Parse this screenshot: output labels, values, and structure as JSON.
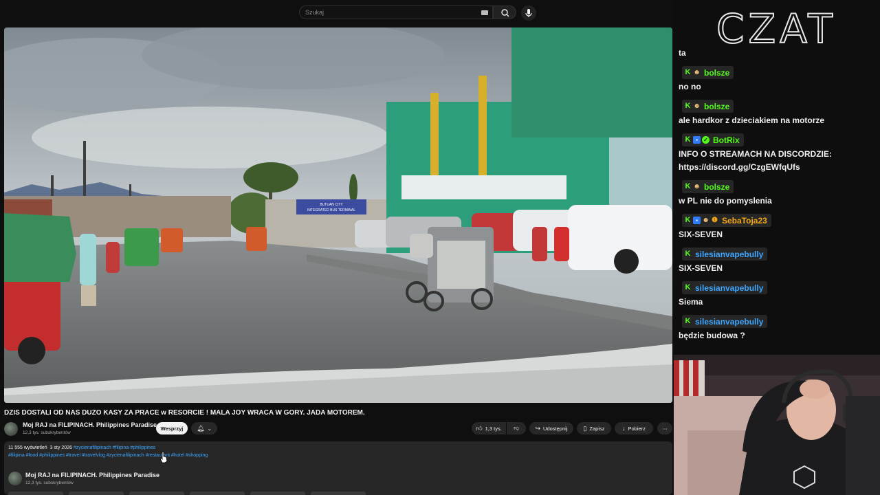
{
  "search": {
    "placeholder": "Szukaj"
  },
  "video": {
    "title": "DZIS DOSTALI OD NAS DUZO KASY ZA PRACE w RESORCIE ! MALA JOY WRACA W GORY. JADA MOTOREM.",
    "channel_name": "Moj RAJ na FILIPINACH.   Philippines Paradise",
    "channel_subs": "12,3 tys. subskrybentów",
    "support_label": "Wesprzyj",
    "likes": "1,3 tys.",
    "share_label": "Udostępnij",
    "save_label": "Zapisz",
    "download_label": "Pobierz",
    "sign_texts": {
      "city": "BUTUAN CITY",
      "terminal": "INTEGRATED BUS TERMINAL"
    }
  },
  "description": {
    "views": "11 555 wyświetleń",
    "date": "3 sty 2026",
    "tags_line1": "#zycienafilipinach #filipina #philippines",
    "tags_line2": "#filipina #food #philippines #travel #travelvlog #zycienafilipinach #restaurant #hotel #shopping",
    "channel_name": "Moj RAJ na FILIPINACH. Philippines Paradise",
    "channel_subs": "12,3 tys. subskrybentów"
  },
  "chat": {
    "header": "CZAT",
    "colors": {
      "kick_green": "#53fc18",
      "bolsze": "#53fc18",
      "botrix": "#53fc18",
      "sebatoja": "#f3a712",
      "silesian": "#3ea6ff"
    },
    "messages": [
      {
        "text": "ta"
      },
      {
        "user": "bolsze",
        "badges": [
          "kick-icon",
          "face-icon"
        ],
        "text": "no no"
      },
      {
        "user": "bolsze",
        "badges": [
          "kick-icon",
          "face-icon"
        ],
        "text": "ale hardkor z dzieciakiem na motorze"
      },
      {
        "user": "BotRix",
        "badges": [
          "kick-icon",
          "bot-icon",
          "verified-icon"
        ],
        "text": "INFO O STREAMACH NA DISCORDZIE:",
        "text2": "https://discord.gg/CzgEWfqUfs"
      },
      {
        "user": "bolsze",
        "badges": [
          "kick-icon",
          "face-icon"
        ],
        "text": "w PL nie do pomyslenia"
      },
      {
        "user": "SebaToja23",
        "badges": [
          "kick-icon",
          "bot-icon",
          "face-icon",
          "gift-icon"
        ],
        "text": "SIX-SEVEN"
      },
      {
        "user": "silesianvapebully",
        "badges": [
          "kick-icon"
        ],
        "text": "SIX-SEVEN"
      },
      {
        "user": "silesianvapebully",
        "badges": [
          "kick-icon"
        ],
        "text": "Siema"
      },
      {
        "user": "silesianvapebully",
        "badges": [
          "kick-icon"
        ],
        "text": "będzie budowa ?"
      }
    ]
  }
}
